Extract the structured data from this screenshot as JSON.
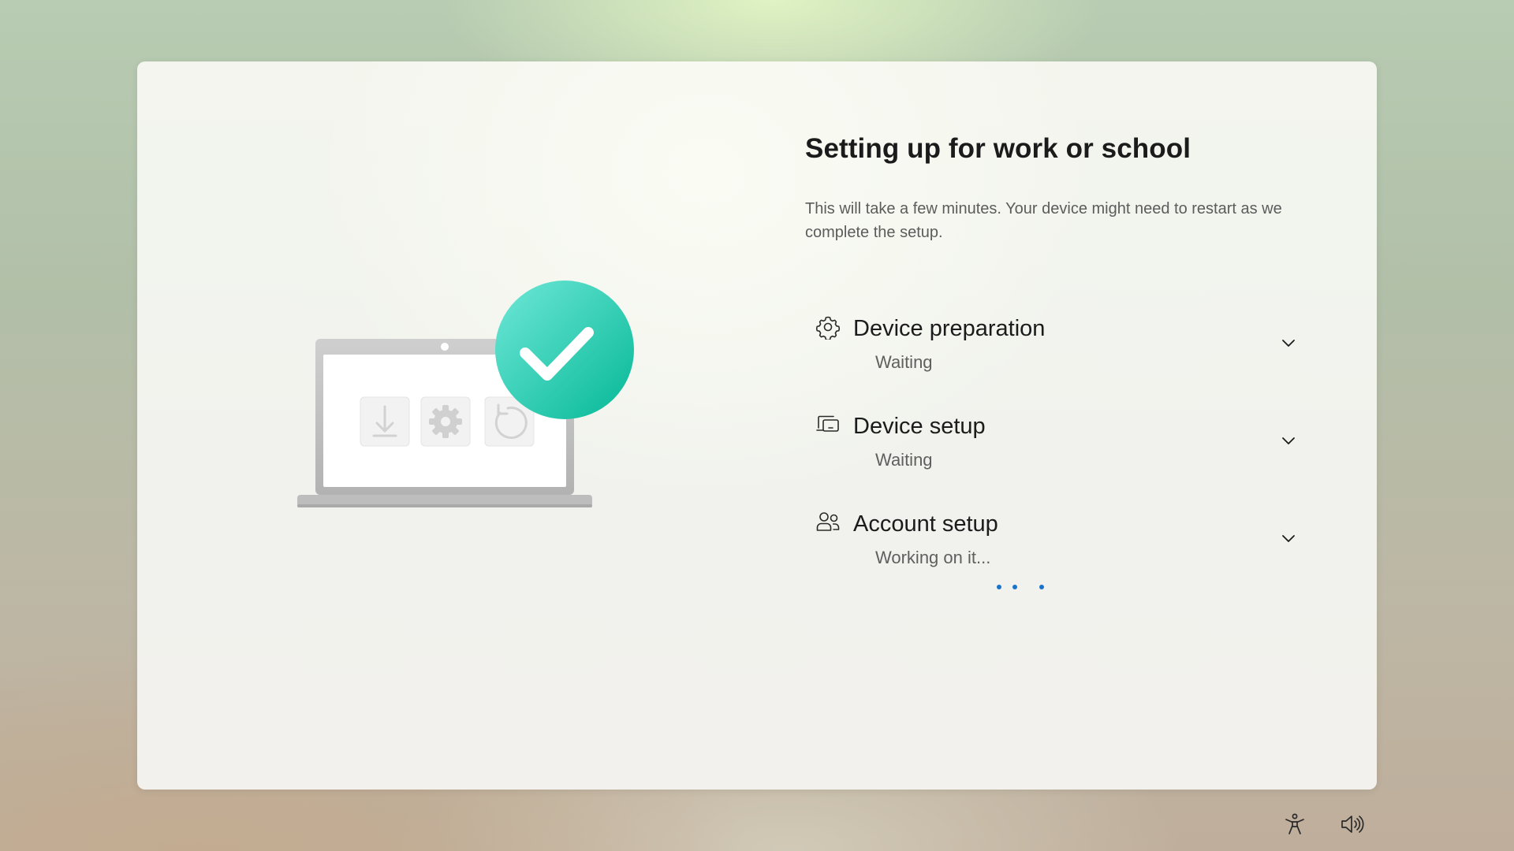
{
  "page": {
    "title": "Setting up for work or school",
    "subtitle": "This will take a few minutes. Your device might need to restart as we complete the setup."
  },
  "steps": [
    {
      "label": "Device preparation",
      "status": "Waiting",
      "icon": "gear-icon"
    },
    {
      "label": "Device setup",
      "status": "Waiting",
      "icon": "device-setup-icon"
    },
    {
      "label": "Account setup",
      "status": "Working on it...",
      "icon": "people-icon"
    }
  ],
  "footer": {
    "accessibility_icon": "accessibility-icon",
    "volume_icon": "volume-icon"
  },
  "colors": {
    "accent": "#1a73c8",
    "check_badge": "#19c7a6",
    "text_primary": "#1b1b1b",
    "text_secondary": "#5f5f5f"
  }
}
